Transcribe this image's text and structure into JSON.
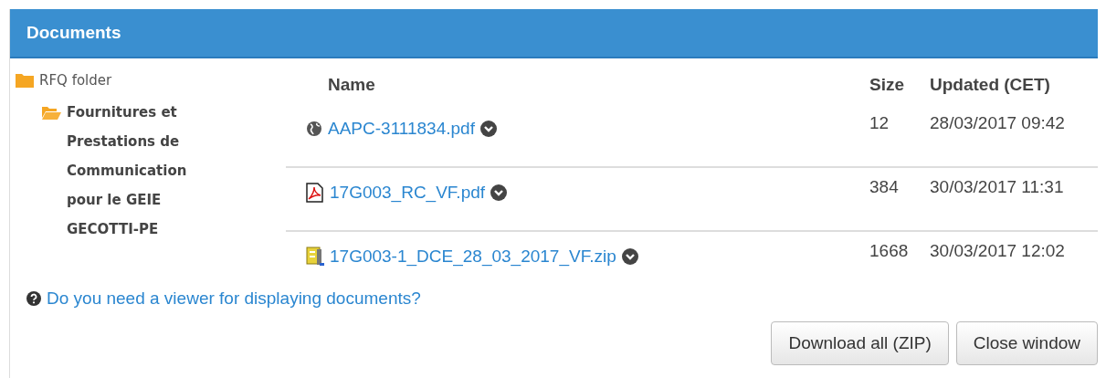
{
  "panel": {
    "title": "Documents"
  },
  "tree": [
    {
      "label": "RFQ folder",
      "expanded": false,
      "selected": false,
      "children": [
        {
          "label": "Fournitures et Prestations de Communication pour le GEIE GECOTTI-PE",
          "expanded": true,
          "selected": true
        }
      ]
    }
  ],
  "table": {
    "columns": [
      "Name",
      "Size",
      "Updated (CET)"
    ],
    "rows": [
      {
        "kind": "web",
        "name": "AAPC-3111834.pdf",
        "size": "12",
        "updated": "28/03/2017 09:42"
      },
      {
        "kind": "pdf",
        "name": "17G003_RC_VF.pdf",
        "size": "384",
        "updated": "30/03/2017 11:31"
      },
      {
        "kind": "zip",
        "name": "17G003-1_DCE_28_03_2017_VF.zip",
        "size": "1668",
        "updated": "30/03/2017 12:02"
      }
    ]
  },
  "help_link": "Do you need a viewer for displaying documents?",
  "buttons": [
    "Download all (ZIP)",
    "Close window"
  ]
}
